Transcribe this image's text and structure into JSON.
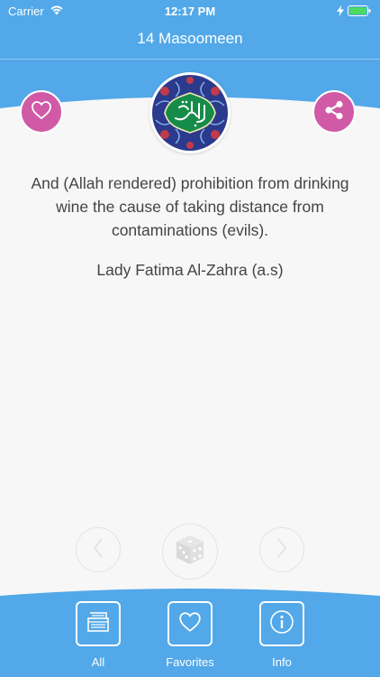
{
  "status": {
    "carrier": "Carrier",
    "time": "12:17 PM"
  },
  "header": {
    "title": "14 Masoomeen"
  },
  "quote": {
    "text": "And (Allah rendered) prohibition from drinking wine the cause of taking distance from contaminations (evils).",
    "author": "Lady Fatima Al-Zahra (a.s)"
  },
  "tabs": [
    {
      "label": "All",
      "icon": "stack-icon"
    },
    {
      "label": "Favorites",
      "icon": "heart-icon"
    },
    {
      "label": "Info",
      "icon": "info-icon"
    }
  ],
  "colors": {
    "accent_blue": "#52a8e8",
    "accent_pink": "#d05aa6",
    "background": "#f7f7f7"
  }
}
